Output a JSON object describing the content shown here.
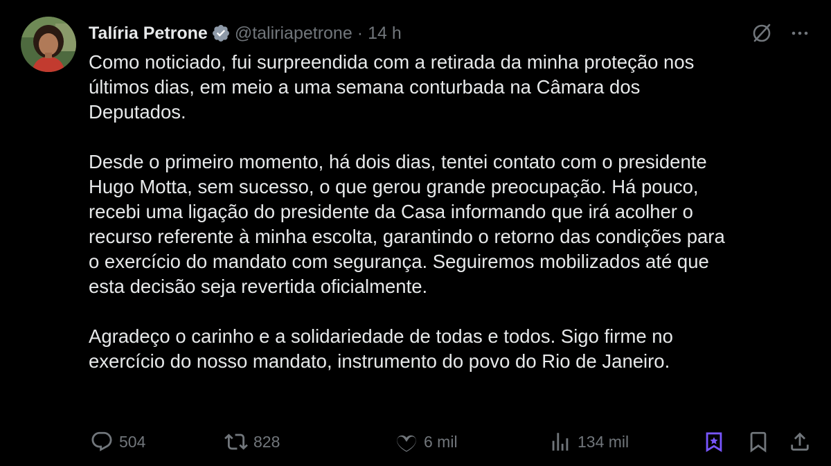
{
  "tweet": {
    "author": {
      "display_name": "Talíria Petrone",
      "handle": "@taliriapetrone",
      "separator": "·",
      "time": "14 h",
      "verified": true
    },
    "paragraphs": [
      "Como noticiado, fui surpreendida com a retirada da minha proteção nos\núltimos dias, em meio a uma semana conturbada na Câmara dos\nDeputados.",
      "Desde o primeiro momento, há dois dias, tentei contato com o presidente\nHugo Motta, sem sucesso, o que gerou grande preocupação. Há pouco,\nrecebi uma ligação do presidente da Casa informando que irá acolher o\nrecurso referente à minha escolta, garantindo o retorno das condições para\no exercício do mandato com segurança. Seguiremos mobilizados até que\nesta decisão seja revertida oficialmente.",
      "Agradeço o carinho e a solidariedade de todas e todos. Sigo firme no\nexercício do nosso mandato, instrumento do povo do Rio de Janeiro."
    ],
    "metrics": {
      "replies": "504",
      "reposts": "828",
      "likes": "6 mil",
      "views": "134 mil"
    },
    "icons": {
      "verified": "verified-badge-icon",
      "grok": "grok-icon",
      "more": "more-icon",
      "reply": "reply-icon",
      "repost": "repost-icon",
      "like": "like-icon",
      "views": "views-icon",
      "grok_bookmark": "grok-bookmark-icon",
      "bookmark": "bookmark-icon",
      "share": "share-icon"
    },
    "colors": {
      "background": "#000000",
      "text": "#e7e9ea",
      "secondary": "#71767b",
      "accent_purple": "#7856ff"
    }
  }
}
